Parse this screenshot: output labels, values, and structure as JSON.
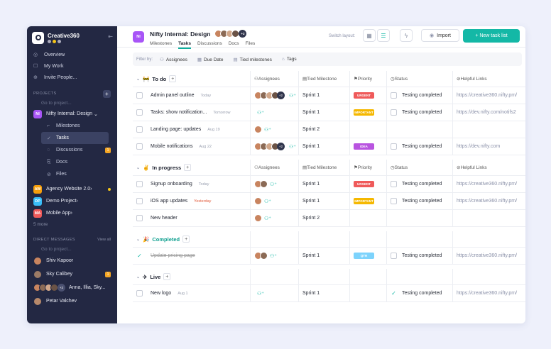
{
  "workspace": {
    "name": "Creative360"
  },
  "sidebar": {
    "nav": [
      {
        "label": "Overview",
        "icon": "overview-icon",
        "glyph": "◎"
      },
      {
        "label": "My Work",
        "icon": "my-work-icon",
        "glyph": "☐"
      },
      {
        "label": "Invite People...",
        "icon": "invite-icon",
        "glyph": "⊕"
      }
    ],
    "projects_title": "PROJECTS",
    "search_placeholder": "Go to project...",
    "current_project": {
      "abbr": "NI",
      "name": "Nifty Internal: Design",
      "color": "#a855f7"
    },
    "subitems": [
      {
        "label": "Milestones",
        "glyph": "⌐",
        "active": false
      },
      {
        "label": "Tasks",
        "glyph": "✓",
        "active": true
      },
      {
        "label": "Discussions",
        "glyph": "◌",
        "active": false,
        "badge": "1"
      },
      {
        "label": "Docs",
        "glyph": "⎘",
        "active": false
      },
      {
        "label": "Files",
        "glyph": "⊘",
        "active": false
      }
    ],
    "projects": [
      {
        "abbr": "AW",
        "name": "Agency Website 2.0",
        "color": "#f59e0b",
        "dot": true
      },
      {
        "abbr": "DP",
        "name": "Demo Project",
        "color": "#38bdf8"
      },
      {
        "abbr": "MA",
        "name": "Mobile App",
        "color": "#ef5a5a"
      }
    ],
    "more": "5 more",
    "dm_title": "DIRECT MESSAGES",
    "dm_view_all": "View all",
    "dm_search_placeholder": "Go to project...",
    "dms": [
      {
        "name": "Shiv Kapoor"
      },
      {
        "name": "Sky Calibey",
        "badge": "1"
      },
      {
        "name": "Anna, Illia, Sky...",
        "group": true,
        "count": "+2"
      },
      {
        "name": "Petar Valchev"
      }
    ]
  },
  "header": {
    "abbr": "NI",
    "title": "Nifty Internal: Design",
    "member_count": "+2",
    "tabs": [
      "Milestones",
      "Tasks",
      "Discussions",
      "Docs",
      "Files"
    ],
    "active_tab": 1,
    "switch_layout": "Switch layout:",
    "import": "Import",
    "new_task_list": "+ New task list"
  },
  "filters": {
    "label": "Filter by:",
    "chips": [
      {
        "label": "Assignees",
        "glyph": "⚇"
      },
      {
        "label": "Due Date",
        "glyph": "▦"
      },
      {
        "label": "Tied milestones",
        "glyph": "▤"
      },
      {
        "label": "Tags",
        "glyph": "⌂"
      }
    ]
  },
  "columns": {
    "assignees": "Assignees",
    "milestone": "Tied Milestone",
    "priority": "Priority",
    "status": "Status",
    "links": "Helpful Links"
  },
  "groups": [
    {
      "name": "To do",
      "emoji": "🚧",
      "color": "#1f2330",
      "tasks": [
        {
          "name": "Admin panel outline",
          "due": "Today",
          "avatars": 4,
          "count": "+2",
          "milestone": "Sprint 1",
          "priority": "URGENT",
          "pcolor": "#ef5a5a",
          "status": "Testing completed",
          "link": "https://creative360.nifty.pm/"
        },
        {
          "name": "Tasks: show notification...",
          "due": "Tomorrow",
          "avatars": 0,
          "milestone": "Sprint 1",
          "priority": "IMPORTANT",
          "pcolor": "#f5b800",
          "status": "Testing completed",
          "link": "https://dev.nifty.com/notifs2"
        },
        {
          "name": "Landing page: updates",
          "due": "Aug 19",
          "avatars": 1,
          "milestone": "Sprint 2",
          "priority": "",
          "pcolor": "",
          "status": "",
          "link": ""
        },
        {
          "name": "Mobile notifications",
          "due": "Aug 22",
          "avatars": 4,
          "count": "+2",
          "milestone": "Sprint 1",
          "priority": "IDEA",
          "pcolor": "#b954e0",
          "status": "Testing completed",
          "link": "https://dev.nifty.com"
        }
      ]
    },
    {
      "name": "In progress",
      "emoji": "✌",
      "color": "#1f2330",
      "tasks": [
        {
          "name": "Signup onboarding",
          "due": "Today",
          "avatars": 2,
          "milestone": "Sprint 1",
          "priority": "URGENT",
          "pcolor": "#ef5a5a",
          "status": "Testing completed",
          "link": "https://creative360.nifty.pm/"
        },
        {
          "name": "iOS app updates",
          "due": "Yesterday",
          "dueRed": true,
          "avatars": 1,
          "milestone": "Sprint 1",
          "priority": "IMPORTANT",
          "pcolor": "#f5b800",
          "status": "Testing completed",
          "link": "https://creative360.nifty.pm/"
        },
        {
          "name": "New header",
          "due": "",
          "avatars": 1,
          "milestone": "Sprint 2",
          "priority": "",
          "pcolor": "",
          "status": "",
          "link": ""
        }
      ]
    },
    {
      "name": "Completed",
      "emoji": "🎉",
      "color": "#0e9f8f",
      "tasks": [
        {
          "name": "Update pricing page",
          "due": "",
          "done": true,
          "avatars": 2,
          "milestone": "Sprint 1",
          "priority": "QTR",
          "pcolor": "#7dd3fc",
          "status": "Testing completed",
          "link": "https://creative360.nifty.pm/"
        }
      ]
    },
    {
      "name": "Live",
      "emoji": "✈",
      "color": "#1f2330",
      "tasks": [
        {
          "name": "New logo",
          "due": "Aug 1",
          "avatars": 0,
          "milestone": "Sprint 1",
          "priority": "",
          "pcolor": "",
          "status": "Testing completed",
          "statusDone": true,
          "link": "https://creative360.nifty.pm/"
        }
      ]
    }
  ]
}
